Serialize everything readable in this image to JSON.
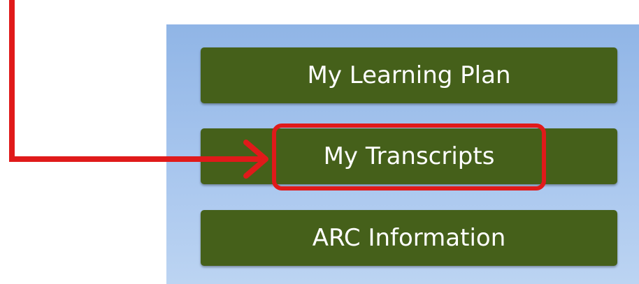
{
  "top_caption": "                                                                                                    ",
  "menu": {
    "items": [
      {
        "label": "My Learning Plan"
      },
      {
        "label": "My Transcripts"
      },
      {
        "label": "ARC Information"
      }
    ]
  },
  "annotation": {
    "highlighted_item": "My Transcripts",
    "color": "#e01a1a"
  },
  "colors": {
    "button_bg": "#45601a",
    "panel_bg": "#a8c6ee"
  }
}
